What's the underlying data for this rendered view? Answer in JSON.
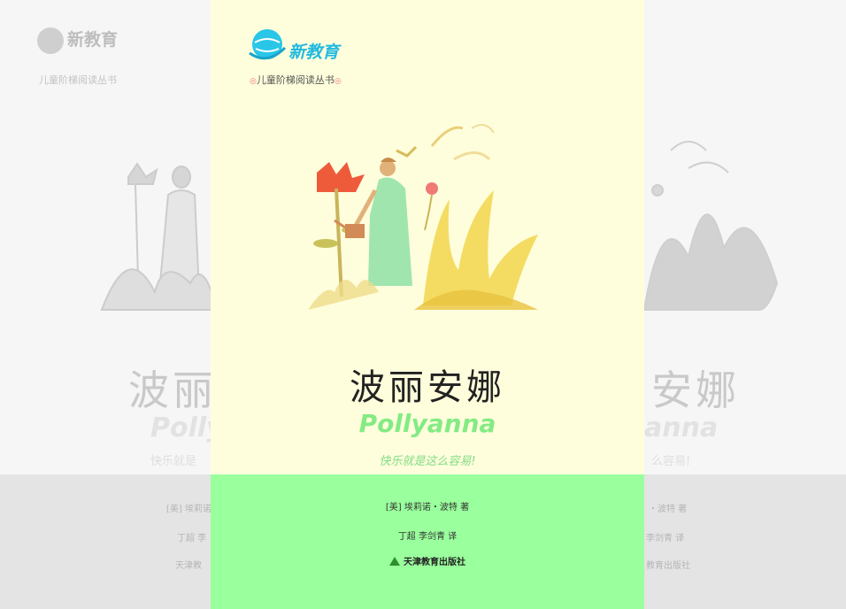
{
  "cover": {
    "logo_text": "新教育",
    "series": "儿童阶梯阅读丛书",
    "title_cn": "波丽安娜",
    "title_en": "Pollyanna",
    "tagline": "快乐就是这么容易!",
    "author": "[美] 埃莉诺・波特 著",
    "translators": "丁超   李剑青 译",
    "publisher": "天津教育出版社",
    "colors": {
      "cover_bg": "#fefedc",
      "bottom_band": "#9aff9d",
      "accent_green": "#84eb84",
      "logo_blue": "#22b9e0"
    }
  },
  "backdrop": {
    "logo_text": "新教育",
    "series": "儿童阶梯阅读丛书",
    "title_left": "波丽",
    "title_right": "安娜",
    "en_left": "Polly",
    "en_right": "anna",
    "tag_left": "快乐就是",
    "tag_right": "么容易!",
    "author_left": "[美] 埃莉诺",
    "author_right": "・波特 著",
    "translators_left": "丁超   李",
    "translators_right": "李剑青 译",
    "publisher_left": "天津教",
    "publisher_right": "教育出版社"
  }
}
